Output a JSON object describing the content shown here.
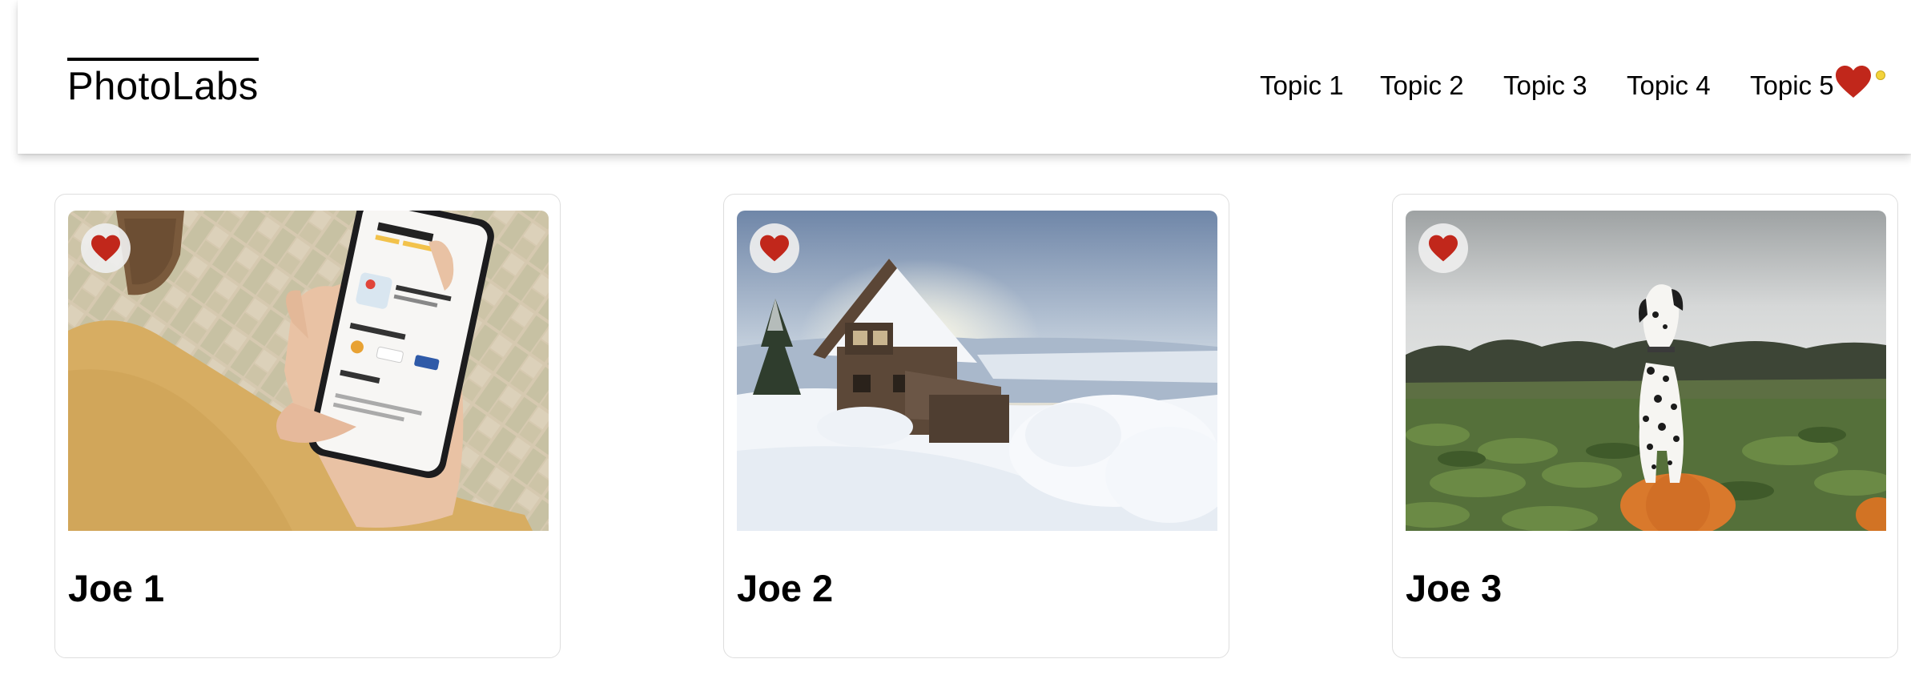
{
  "app": {
    "logo": "PhotoLabs",
    "brand_color": "#c1271b"
  },
  "nav": {
    "topics": [
      "Topic 1",
      "Topic 2",
      "Topic 3",
      "Topic 4",
      "Topic 5"
    ],
    "favourites_icon": "heart-icon",
    "notification_dot_color": "#f3d33b"
  },
  "photos": [
    {
      "name": "Joe 1",
      "subject": "hand-holding-phone",
      "favourite_icon": "heart-icon"
    },
    {
      "name": "Joe 2",
      "subject": "snowy-cabin",
      "favourite_icon": "heart-icon"
    },
    {
      "name": "Joe 3",
      "subject": "dalmatian-on-pumpkin",
      "favourite_icon": "heart-icon"
    }
  ]
}
